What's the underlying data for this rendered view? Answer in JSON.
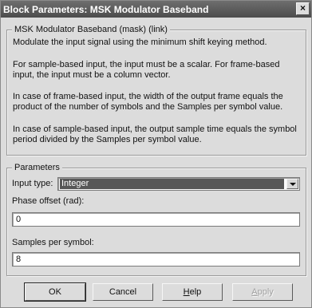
{
  "window": {
    "title": "Block Parameters: MSK Modulator Baseband",
    "close_glyph": "×",
    "close_icon": "close-icon"
  },
  "description": {
    "legend": "MSK Modulator Baseband (mask) (link)",
    "paragraphs": [
      "Modulate the input signal using the minimum shift keying method.",
      "For sample-based input, the input must be a scalar. For frame-based input, the input must be a column vector.",
      "In case of frame-based input, the width of the output frame equals the product of the number of symbols and the Samples per symbol value.",
      "In case of sample-based input, the output sample time equals the symbol period divided by the Samples per symbol value."
    ]
  },
  "parameters": {
    "legend": "Parameters",
    "input_type": {
      "label": "Input type:",
      "value": "Integer",
      "arrow_icon": "chevron-down-icon"
    },
    "phase_offset": {
      "label": "Phase offset (rad):",
      "value": "0"
    },
    "samples_per_symbol": {
      "label": "Samples per symbol:",
      "value": "8"
    }
  },
  "buttons": {
    "ok": "OK",
    "cancel": "Cancel",
    "help_prefix": "H",
    "help_rest": "elp",
    "apply_prefix": "A",
    "apply_rest": "pply",
    "apply_enabled": false
  }
}
